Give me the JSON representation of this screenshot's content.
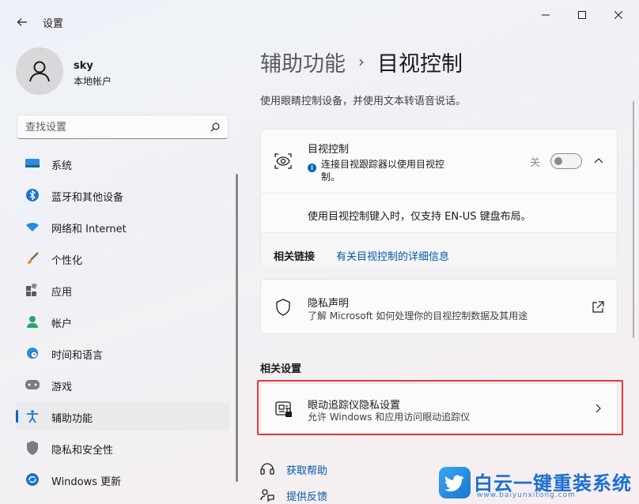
{
  "app": {
    "title": "设置"
  },
  "profile": {
    "name": "sky",
    "account_type": "本地帐户"
  },
  "search": {
    "placeholder": "查找设置"
  },
  "sidebar": {
    "items": [
      {
        "label": "系统",
        "icon": "monitor-icon"
      },
      {
        "label": "蓝牙和其他设备",
        "icon": "bluetooth-icon"
      },
      {
        "label": "网络和 Internet",
        "icon": "wifi-icon"
      },
      {
        "label": "个性化",
        "icon": "brush-icon"
      },
      {
        "label": "应用",
        "icon": "apps-icon"
      },
      {
        "label": "帐户",
        "icon": "person-icon"
      },
      {
        "label": "时间和语言",
        "icon": "globe-clock-icon"
      },
      {
        "label": "游戏",
        "icon": "gamepad-icon"
      },
      {
        "label": "辅助功能",
        "icon": "accessibility-icon",
        "active": true
      },
      {
        "label": "隐私和安全性",
        "icon": "shield-icon"
      },
      {
        "label": "Windows 更新",
        "icon": "update-icon"
      }
    ]
  },
  "main": {
    "breadcrumb_parent": "辅助功能",
    "breadcrumb_sep": "›",
    "breadcrumb_current": "目视控制",
    "description": "使用眼睛控制设备，并使用文本转语音说话。",
    "eye_control": {
      "title": "目视控制",
      "info": "连接目视跟踪器以使用目视控制。",
      "toggle_state": "关",
      "note": "使用目视控制键入时，仅支持 EN-US 键盘布局。",
      "related_links_label": "相关链接",
      "related_link": "有关目视控制的详细信息"
    },
    "privacy": {
      "title": "隐私声明",
      "description": "了解 Microsoft 如何处理你的目视控制数据及其用途"
    },
    "related_settings_title": "相关设置",
    "eye_tracker": {
      "title": "眼动追踪仪隐私设置",
      "description": "允许 Windows 和应用访问眼动追踪仪"
    },
    "help": {
      "get_help": "获取帮助",
      "feedback": "提供反馈"
    }
  },
  "watermark": {
    "title": "白云一键重装系统",
    "url": "www.baiyunxitong.com"
  },
  "colors": {
    "accent": "#0067c0",
    "link": "#0058b0",
    "highlight": "#e03a3a"
  }
}
